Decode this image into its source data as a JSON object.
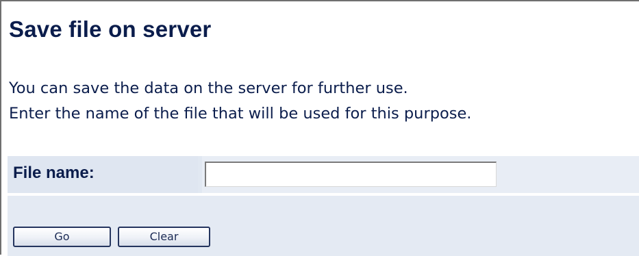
{
  "page": {
    "title": "Save file on server",
    "description_line1": "You can save the data on the server for further use.",
    "description_line2": "Enter the name of the file that will be used for this purpose."
  },
  "form": {
    "file_name_label": "File name:",
    "file_name_value": "",
    "go_label": "Go",
    "clear_label": "Clear"
  },
  "colors": {
    "text": "#0b1d4c",
    "panel_background": "#e1e8f2",
    "button_border": "#24345e"
  }
}
